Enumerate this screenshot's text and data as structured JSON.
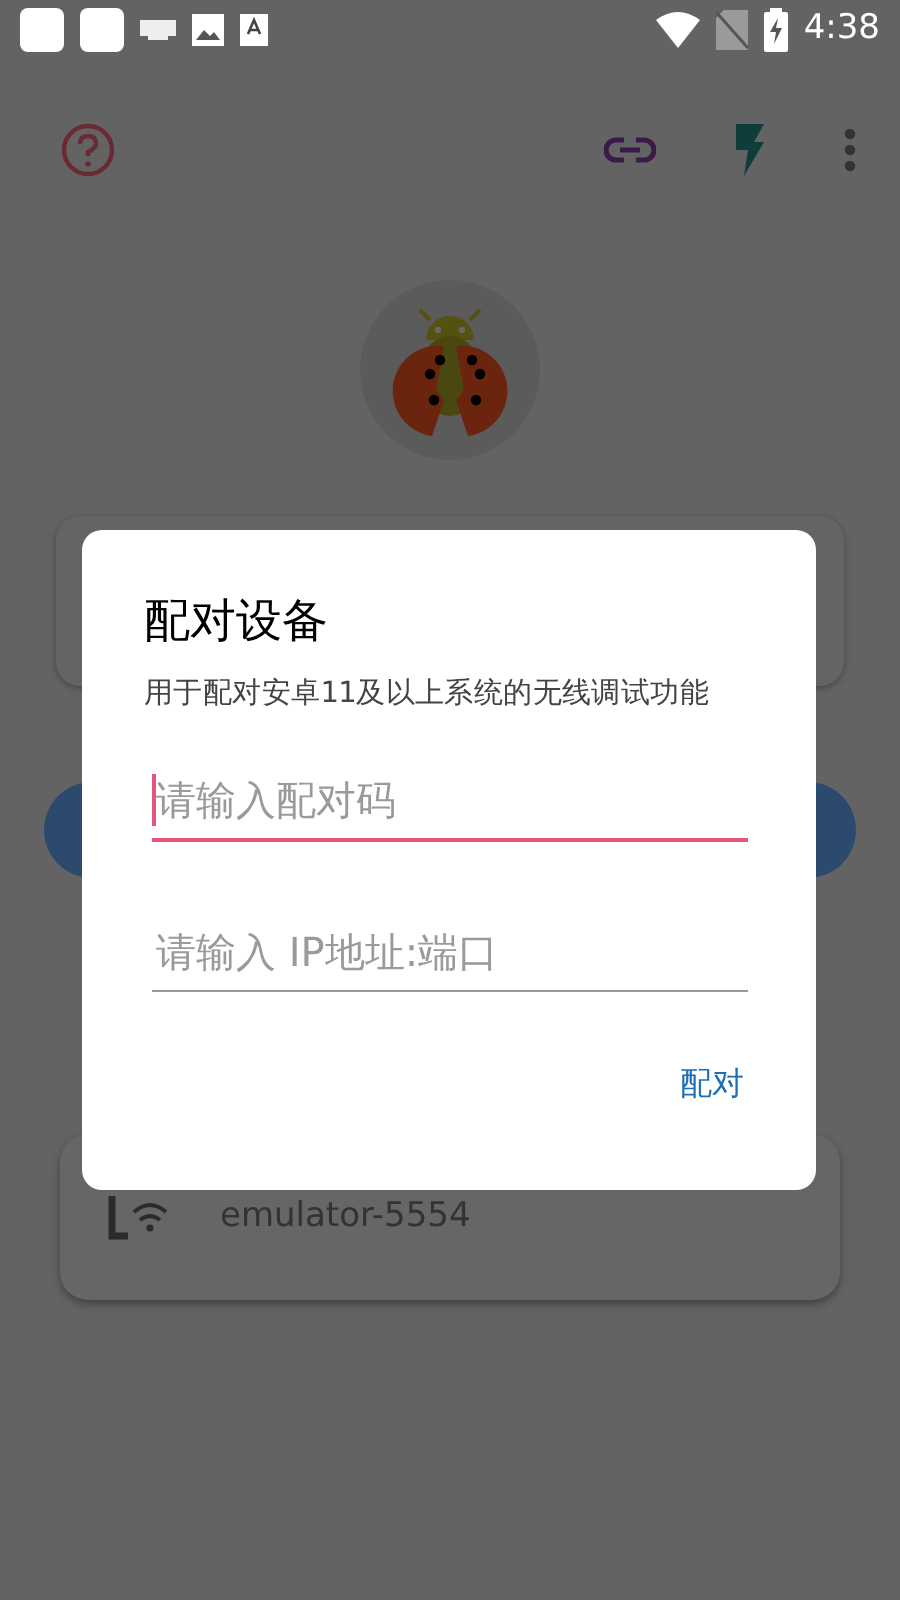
{
  "status_bar": {
    "time": "4:38"
  },
  "device": {
    "name": "emulator-5554"
  },
  "dialog": {
    "title": "配对设备",
    "description": "用于配对安卓11及以上系统的无线调试功能",
    "fields": [
      {
        "placeholder": "请输入配对码",
        "focused": true
      },
      {
        "placeholder": "请输入 IP地址:端口",
        "focused": false
      }
    ],
    "button": "配对"
  }
}
